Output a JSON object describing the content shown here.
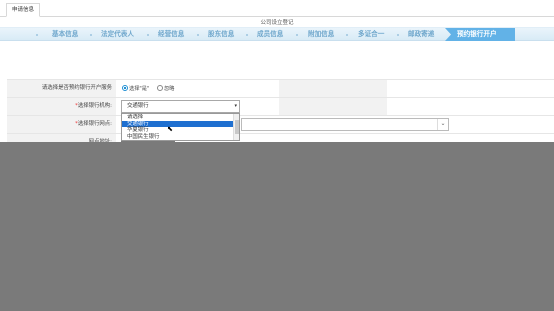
{
  "tabs": [
    "申请信息"
  ],
  "page_title": "公司设立登记",
  "steps": [
    "基本信息",
    "法定代表人",
    "经营信息",
    "股东信息",
    "成员信息",
    "附加信息",
    "多证合一",
    "邮政寄递",
    "预约银行开户"
  ],
  "active_step_index": 8,
  "form": {
    "row1": {
      "label": "请选择是否预约银行开户服务",
      "option_yes": "选择\"是\"",
      "option_no": "忽略",
      "selected": "yes"
    },
    "row2": {
      "label_req": "*",
      "label": "选择银行机构:",
      "value": "交通银行",
      "arrow": "▾"
    },
    "row3": {
      "label_req": "*",
      "label": "选择银行网点:",
      "chevron": "⌄"
    },
    "row4": {
      "label": "网点地址:"
    }
  },
  "dropdown": {
    "options": [
      "请选择",
      "交通银行",
      "华夏银行",
      "中国民生银行"
    ],
    "selected_index": 1
  },
  "colors": {
    "accent": "#62b2e7",
    "step_text": "#6fa7cc",
    "overlay": "#7a7a7a",
    "selected_option": "#1e6fd0"
  }
}
